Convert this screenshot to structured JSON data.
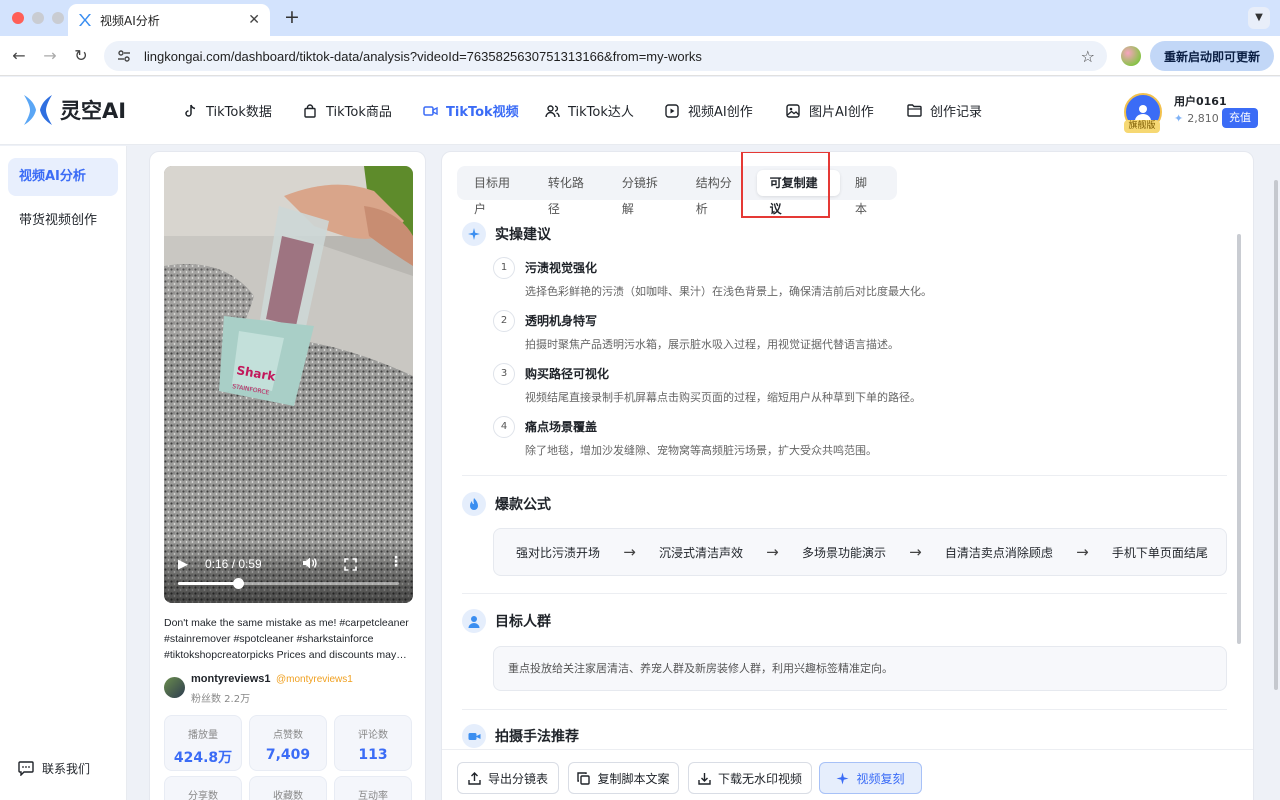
{
  "browser": {
    "tab_title": "视频AI分析",
    "url": "lingkongai.com/dashboard/tiktok-data/analysis?videoId=7635825630751313166&from=my-works",
    "restart_label": "重新启动即可更新"
  },
  "app": {
    "logo_text": "灵空AI",
    "nav": [
      {
        "label": "TikTok数据",
        "icon": "tiktok-icon"
      },
      {
        "label": "TikTok商品",
        "icon": "shopping-bag-icon"
      },
      {
        "label": "TikTok视频",
        "icon": "video-camera-icon"
      },
      {
        "label": "TikTok达人",
        "icon": "users-icon"
      },
      {
        "label": "视频AI创作",
        "icon": "video-create-icon"
      },
      {
        "label": "图片AI创作",
        "icon": "image-icon"
      },
      {
        "label": "创作记录",
        "icon": "folder-icon"
      }
    ],
    "active_nav": "TikTok视频",
    "user": {
      "name": "用户0161",
      "badge": "旗舰版",
      "credits": "2,810",
      "recharge_label": "充值"
    }
  },
  "sidebar": {
    "items": [
      {
        "label": "视频AI分析",
        "active": true
      },
      {
        "label": "带货视频创作",
        "active": false
      }
    ],
    "contact_label": "联系我们"
  },
  "video": {
    "current_time": "0:16",
    "duration": "0:59",
    "progress_fraction": 0.27,
    "description": "Don't make the same mistake as me! #carpetcleaner #stainremover #spotcleaner #sharkstainforce #tiktokshopcreatorpicks Prices and discounts may…",
    "creator_name": "montyreviews1",
    "creator_handle": "@montyreviews1",
    "fans": "粉丝数 2.2万",
    "stats": [
      {
        "label": "播放量",
        "value": "424.8万"
      },
      {
        "label": "点赞数",
        "value": "7,409"
      },
      {
        "label": "评论数",
        "value": "113"
      },
      {
        "label": "分享数",
        "value": ""
      },
      {
        "label": "收藏数",
        "value": ""
      },
      {
        "label": "互动率",
        "value": ""
      }
    ],
    "product_brand": "Shark",
    "product_model": "STAINFORCE"
  },
  "analysis": {
    "tabs": [
      "目标用户",
      "转化路径",
      "分镜拆解",
      "结构分析",
      "可复制建议",
      "脚本"
    ],
    "active_tab": "可复制建议",
    "section_practical": {
      "title": "实操建议",
      "tips": [
        {
          "num": "1",
          "title": "污渍视觉强化",
          "desc": "选择色彩鲜艳的污渍（如咖啡、果汁）在浅色背景上，确保清洁前后对比度最大化。"
        },
        {
          "num": "2",
          "title": "透明机身特写",
          "desc": "拍摄时聚焦产品透明污水箱，展示脏水吸入过程，用视觉证据代替语言描述。"
        },
        {
          "num": "3",
          "title": "购买路径可视化",
          "desc": "视频结尾直接录制手机屏幕点击购买页面的过程，缩短用户从种草到下单的路径。"
        },
        {
          "num": "4",
          "title": "痛点场景覆盖",
          "desc": "除了地毯，增加沙发缝隙、宠物窝等高频脏污场景，扩大受众共鸣范围。"
        }
      ]
    },
    "section_formula": {
      "title": "爆款公式",
      "steps": [
        "强对比污渍开场",
        "沉浸式清洁声效",
        "多场景功能演示",
        "自清洁卖点消除顾虑",
        "手机下单页面结尾"
      ],
      "arrow": "→"
    },
    "section_audience": {
      "title": "目标人群",
      "text": "重点投放给关注家居清洁、养宠人群及新房装修人群，利用兴趣标签精准定向。"
    },
    "section_shooting": {
      "title": "拍摄手法推荐"
    },
    "actions": [
      {
        "label": "导出分镜表",
        "icon": "export-icon"
      },
      {
        "label": "复制脚本文案",
        "icon": "copy-icon"
      },
      {
        "label": "下载无水印视频",
        "icon": "download-icon"
      },
      {
        "label": "视频复刻",
        "icon": "sparkle-icon"
      }
    ]
  }
}
